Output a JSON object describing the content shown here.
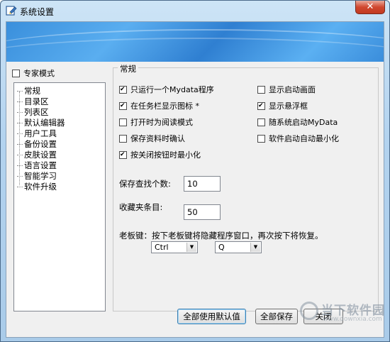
{
  "window": {
    "title": "系统设置",
    "close_glyph": "✕"
  },
  "colors": {
    "banner": "#3a8fdc",
    "title_bar": "#b3d3ef",
    "close": "#d0472f"
  },
  "sidebar": {
    "expert_mode_label": "专家模式",
    "expert_mode_checked": false,
    "items": [
      {
        "label": "常规"
      },
      {
        "label": "目录区"
      },
      {
        "label": "列表区"
      },
      {
        "label": "默认编辑器"
      },
      {
        "label": "用户工具"
      },
      {
        "label": "备份设置"
      },
      {
        "label": "皮肤设置"
      },
      {
        "label": "语言设置"
      },
      {
        "label": "智能学习"
      },
      {
        "label": "软件升级"
      }
    ]
  },
  "group": {
    "title": "常规",
    "left_options": [
      {
        "label": "只运行一个Mydata程序",
        "checked": true
      },
      {
        "label": "在任务栏显示图标 *",
        "checked": true
      },
      {
        "label": "打开时为阅读模式",
        "checked": false
      },
      {
        "label": "保存资料时确认",
        "checked": false
      },
      {
        "label": "按关闭按钮时最小化",
        "checked": true
      }
    ],
    "right_options": [
      {
        "label": "显示启动画面",
        "checked": false
      },
      {
        "label": "显示悬浮框",
        "checked": true
      },
      {
        "label": "随系统启动MyData",
        "checked": false
      },
      {
        "label": "软件启动自动最小化",
        "checked": false
      }
    ],
    "search_count_label": "保存查找个数:",
    "search_count_value": "10",
    "favorites_label": "收藏夹条目:",
    "favorites_value": "50",
    "boss_key_label": "老板键：按下老板键将隐藏程序窗口，再次按下将恢复。",
    "boss_key_modifier": "Ctrl",
    "boss_key_letter": "Q"
  },
  "buttons": {
    "defaults": "全部使用默认值",
    "save_all": "全部保存",
    "close": "关闭"
  },
  "watermark": {
    "text": "当下软件园",
    "url": "www.downxia.com"
  }
}
